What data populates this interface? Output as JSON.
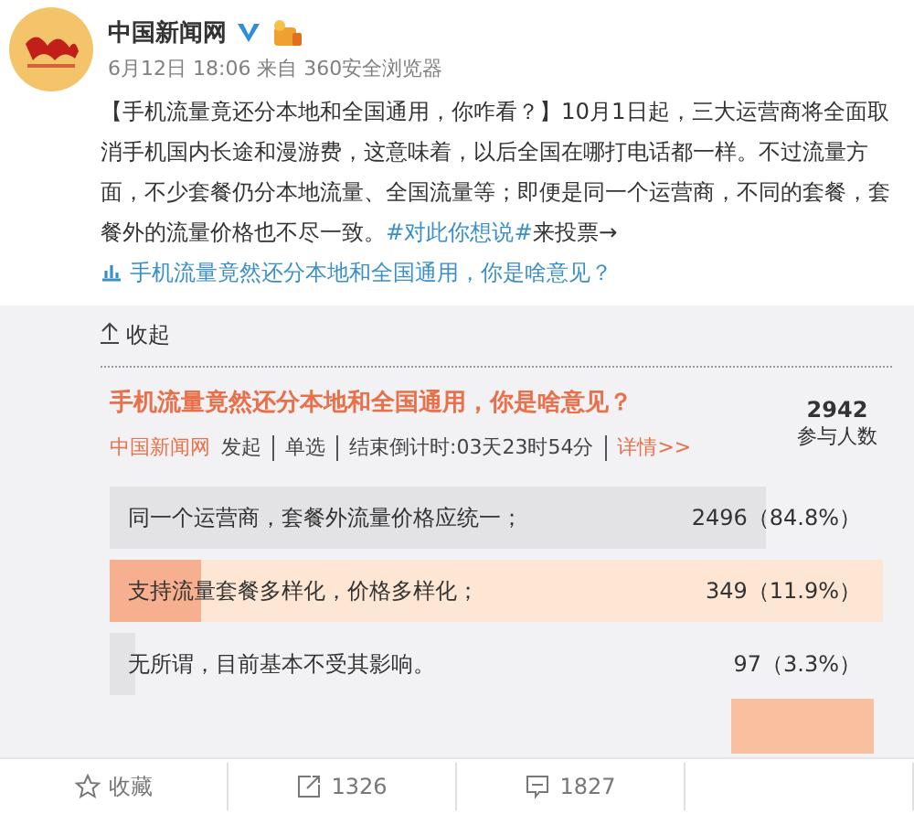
{
  "account": {
    "name": "中国新闻网",
    "verified": true,
    "meta": "6月12日 18:06 来自 360安全浏览器"
  },
  "post": {
    "text": "【手机流量竟还分本地和全国通用，你咋看？】10月1日起，三大运营商将全面取消手机国内长途和漫游费，这意味着，以后全国在哪打电话都一样。不过流量方面，不少套餐仍分本地流量、全国流量等；即便是同一个运营商，不同的套餐，套餐外的流量价格也不尽一致。",
    "hashtag": "#对此你想说#",
    "after": "来投票→",
    "link": "手机流量竟然还分本地和全国通用，你是啥意见？"
  },
  "collapse": "收起",
  "poll": {
    "title": "手机流量竟然还分本地和全国通用，你是啥意见？",
    "initiator": "中国新闻网",
    "initiated": "发起",
    "type": "单选",
    "countdown": "结束倒计时:03天23时54分",
    "details": "详情>>",
    "count": "2942",
    "count_label": "参与人数",
    "options": [
      {
        "label": "同一个运营商，套餐外流量价格应统一；",
        "result": "2496（84.8%）",
        "level": 0.848,
        "selected": false
      },
      {
        "label": "支持流量套餐多样化，价格多样化；",
        "result": "349（11.9%）",
        "level": 0.119,
        "selected": true
      },
      {
        "label": "无所谓，目前基本不受其影响。",
        "result": "97（3.3%）",
        "level": 0.033,
        "selected": false
      }
    ]
  },
  "actions": [
    {
      "kind": "favorite",
      "label": "收藏"
    },
    {
      "kind": "repost",
      "label": "1326"
    },
    {
      "kind": "comment",
      "label": "1827"
    }
  ]
}
